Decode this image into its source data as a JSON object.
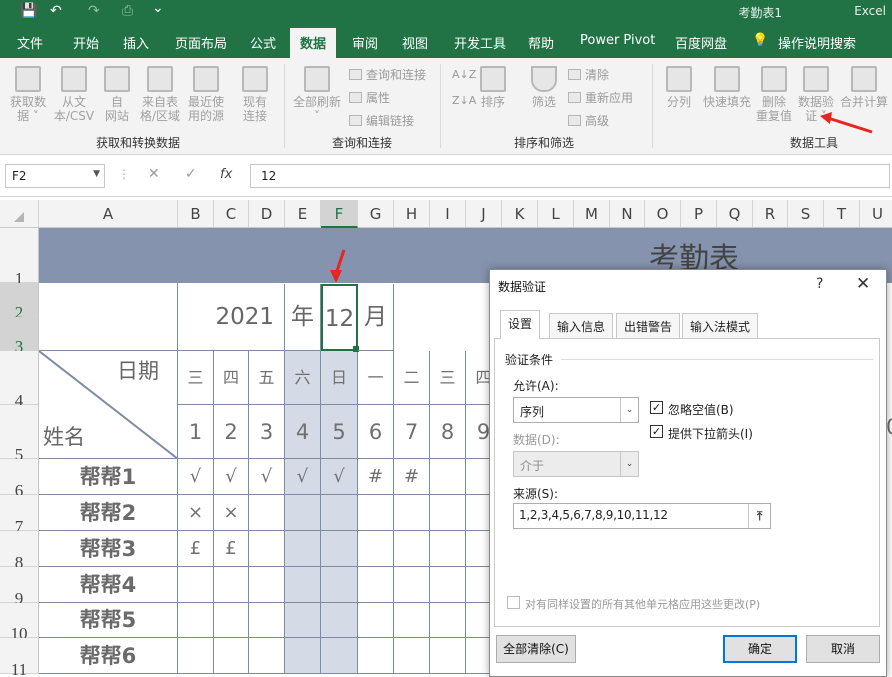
{
  "window": {
    "title": "考勤表1",
    "app": "Excel"
  },
  "quick_access": {
    "save_icon": "💾",
    "undo_icon": "↶",
    "redo_icon": "↷",
    "preview_icon": "⎙",
    "more_icon": "⌄"
  },
  "ribbon_tabs": [
    "文件",
    "开始",
    "插入",
    "页面布局",
    "公式",
    "数据",
    "审阅",
    "视图",
    "开发工具",
    "帮助",
    "Power Pivot",
    "百度网盘",
    "操作说明搜索"
  ],
  "active_tab": "数据",
  "ribbon": {
    "group1": {
      "label": "获取和转换数据",
      "buttons": [
        "获取数\n据 ˅",
        "从文\n本/CSV",
        "自\n网站",
        "来自表\n格/区域",
        "最近使\n用的源",
        "现有\n连接"
      ]
    },
    "group2": {
      "label": "查询和连接",
      "big": "全部刷新\n˅",
      "small": [
        "查询和连接",
        "属性",
        "编辑链接"
      ]
    },
    "group3": {
      "label": "排序和筛选",
      "big": [
        "排序",
        "筛选"
      ],
      "small": [
        "清除",
        "重新应用",
        "高级"
      ],
      "az": "A↓Z",
      "za": "Z↓A"
    },
    "group4": {
      "label": "数据工具",
      "buttons": [
        "分列",
        "快速填充",
        "删除\n重复值",
        "数据验\n证 ˅",
        "合并计算"
      ]
    }
  },
  "formula_bar": {
    "name_box": "F2",
    "cancel": "✕",
    "enter": "✓",
    "fx": "fx",
    "content": "12"
  },
  "columns": [
    "A",
    "B",
    "C",
    "D",
    "E",
    "F",
    "G",
    "H",
    "I",
    "J",
    "K",
    "L",
    "M",
    "N",
    "O",
    "P",
    "Q",
    "R",
    "S",
    "T",
    "U"
  ],
  "rows": [
    "1",
    "2",
    "3",
    "4",
    "5",
    "6",
    "7",
    "8",
    "9",
    "10",
    "11"
  ],
  "sheet": {
    "title": "考勤表",
    "year": "2021",
    "year_unit": "年",
    "month": "12",
    "month_unit": "月",
    "header_date": "日期",
    "header_name": "姓名",
    "weekdays": [
      "三",
      "四",
      "五",
      "六",
      "日",
      "一",
      "二",
      "三",
      "四"
    ],
    "days": [
      "1",
      "2",
      "3",
      "4",
      "5",
      "6",
      "7",
      "8",
      "9"
    ],
    "names": [
      "帮帮1",
      "帮帮2",
      "帮帮3",
      "帮帮4",
      "帮帮5",
      "帮帮6"
    ],
    "marks": [
      [
        "√",
        "√",
        "√",
        "√",
        "√",
        "#",
        "#"
      ],
      [
        "×",
        "×"
      ],
      [
        "£",
        "£"
      ]
    ],
    "clipped_right": "0"
  },
  "dialog": {
    "title": "数据验证",
    "help": "?",
    "close": "✕",
    "tabs": [
      "设置",
      "输入信息",
      "出错警告",
      "输入法模式"
    ],
    "section": "验证条件",
    "allow_label": "允许(A):",
    "allow_value": "序列",
    "ignore_blank": "忽略空值(B)",
    "dropdown": "提供下拉箭头(I)",
    "data_label": "数据(D):",
    "data_value": "介于",
    "source_label": "来源(S):",
    "source_value": "1,2,3,4,5,6,7,8,9,10,11,12",
    "apply_all": "对有同样设置的所有其他单元格应用这些更改(P)",
    "clear_all": "全部清除(C)",
    "ok": "确定",
    "cancel": "取消"
  },
  "colors": {
    "excel_green": "#217346",
    "banner": "#8593ae",
    "weekend": "#d5dbe6",
    "annotation_red": "#e8251f",
    "dialog_blue": "#0078d7"
  }
}
